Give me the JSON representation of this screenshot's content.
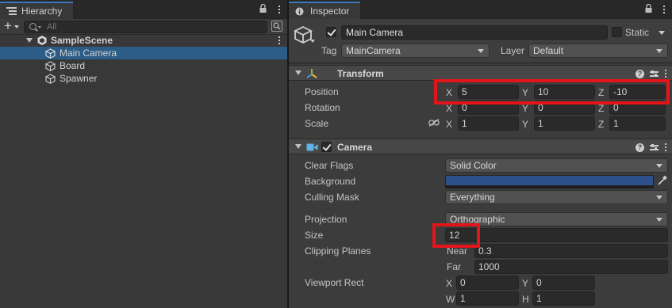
{
  "hierarchy": {
    "tab_label": "Hierarchy",
    "search_placeholder": "All",
    "scene": "SampleScene",
    "items": [
      {
        "label": "Main Camera",
        "selected": true
      },
      {
        "label": "Board",
        "selected": false
      },
      {
        "label": "Spawner",
        "selected": false
      }
    ]
  },
  "inspector": {
    "tab_label": "Inspector",
    "object_name": "Main Camera",
    "active": true,
    "static_label": "Static",
    "static": false,
    "tag_label": "Tag",
    "tag_value": "MainCamera",
    "layer_label": "Layer",
    "layer_value": "Default",
    "transform": {
      "title": "Transform",
      "position_label": "Position",
      "rotation_label": "Rotation",
      "scale_label": "Scale",
      "position": {
        "x": "5",
        "y": "10",
        "z": "-10"
      },
      "rotation": {
        "x": "0",
        "y": "0",
        "z": "0"
      },
      "scale": {
        "x": "1",
        "y": "1",
        "z": "1"
      }
    },
    "camera": {
      "title": "Camera",
      "enabled": true,
      "clear_flags_label": "Clear Flags",
      "clear_flags_value": "Solid Color",
      "background_label": "Background",
      "background_color": "#2d4f8a",
      "culling_mask_label": "Culling Mask",
      "culling_mask_value": "Everything",
      "projection_label": "Projection",
      "projection_value": "Orthographic",
      "size_label": "Size",
      "size_value": "12",
      "clipping_label": "Clipping Planes",
      "near_label": "Near",
      "near_value": "0.3",
      "far_label": "Far",
      "far_value": "1000",
      "viewport_label": "Viewport Rect",
      "viewport": {
        "x": "0",
        "y": "0",
        "w": "1",
        "h": "1"
      }
    }
  },
  "axis_labels": {
    "x": "X",
    "y": "Y",
    "z": "Z",
    "w": "W",
    "h": "H"
  },
  "colors": {
    "selection": "#2c5d87",
    "highlight": "#e3151a",
    "tab_accent": "#3a79bb"
  }
}
